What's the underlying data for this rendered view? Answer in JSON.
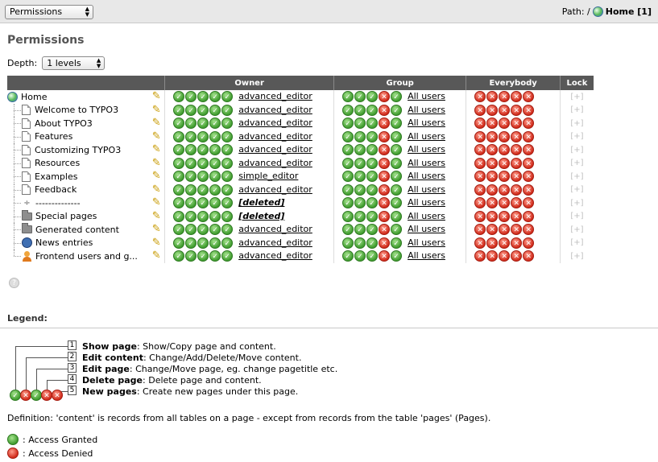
{
  "topbar": {
    "module_select": "Permissions",
    "path_label": "Path: /",
    "path_page": "Home [1]"
  },
  "page_title": "Permissions",
  "depth": {
    "label": "Depth:",
    "value": "1 levels"
  },
  "table": {
    "headers": {
      "owner": "Owner",
      "group": "Group",
      "everybody": "Everybody",
      "lock": "Lock"
    },
    "rows": [
      {
        "title": "Home",
        "icon": "globe-icon",
        "owner": [
          1,
          1,
          1,
          1,
          1
        ],
        "owner_name": "advanced_editor",
        "group": [
          1,
          1,
          1,
          0,
          1
        ],
        "group_name": "All users",
        "every": [
          0,
          0,
          0,
          0,
          0
        ],
        "lock": "[+]"
      },
      {
        "title": "Welcome to TYPO3",
        "icon": "page-icon",
        "owner": [
          1,
          1,
          1,
          1,
          1
        ],
        "owner_name": "advanced_editor",
        "group": [
          1,
          1,
          1,
          0,
          1
        ],
        "group_name": "All users",
        "every": [
          0,
          0,
          0,
          0,
          0
        ],
        "lock": "[+]"
      },
      {
        "title": "About TYPO3",
        "icon": "page-icon",
        "owner": [
          1,
          1,
          1,
          1,
          1
        ],
        "owner_name": "advanced_editor",
        "group": [
          1,
          1,
          1,
          0,
          1
        ],
        "group_name": "All users",
        "every": [
          0,
          0,
          0,
          0,
          0
        ],
        "lock": "[+]"
      },
      {
        "title": "Features",
        "icon": "page-icon",
        "owner": [
          1,
          1,
          1,
          1,
          1
        ],
        "owner_name": "advanced_editor",
        "group": [
          1,
          1,
          1,
          0,
          1
        ],
        "group_name": "All users",
        "every": [
          0,
          0,
          0,
          0,
          0
        ],
        "lock": "[+]"
      },
      {
        "title": "Customizing TYPO3",
        "icon": "page-icon",
        "owner": [
          1,
          1,
          1,
          1,
          1
        ],
        "owner_name": "advanced_editor",
        "group": [
          1,
          1,
          1,
          0,
          1
        ],
        "group_name": "All users",
        "every": [
          0,
          0,
          0,
          0,
          0
        ],
        "lock": "[+]"
      },
      {
        "title": "Resources",
        "icon": "page-icon",
        "owner": [
          1,
          1,
          1,
          1,
          1
        ],
        "owner_name": "advanced_editor",
        "group": [
          1,
          1,
          1,
          0,
          1
        ],
        "group_name": "All users",
        "every": [
          0,
          0,
          0,
          0,
          0
        ],
        "lock": "[+]"
      },
      {
        "title": "Examples",
        "icon": "page-icon",
        "owner": [
          1,
          1,
          1,
          1,
          1
        ],
        "owner_name": "simple_editor",
        "group": [
          1,
          1,
          1,
          0,
          1
        ],
        "group_name": "All users",
        "every": [
          0,
          0,
          0,
          0,
          0
        ],
        "lock": "[+]"
      },
      {
        "title": "Feedback",
        "icon": "page-icon",
        "owner": [
          1,
          1,
          1,
          1,
          1
        ],
        "owner_name": "advanced_editor",
        "group": [
          1,
          1,
          1,
          0,
          1
        ],
        "group_name": "All users",
        "every": [
          0,
          0,
          0,
          0,
          0
        ],
        "lock": "[+]"
      },
      {
        "title": "--------------",
        "icon": "spacer-icon",
        "owner": [
          1,
          1,
          1,
          1,
          1
        ],
        "owner_name": "[deleted]",
        "deleted": true,
        "group": [
          1,
          1,
          1,
          0,
          1
        ],
        "group_name": "All users",
        "every": [
          0,
          0,
          0,
          0,
          0
        ],
        "lock": "[+]"
      },
      {
        "title": "Special pages",
        "icon": "folder-icon",
        "owner": [
          1,
          1,
          1,
          1,
          1
        ],
        "owner_name": "[deleted]",
        "deleted": true,
        "group": [
          1,
          1,
          1,
          0,
          1
        ],
        "group_name": "All users",
        "every": [
          0,
          0,
          0,
          0,
          0
        ],
        "lock": "[+]"
      },
      {
        "title": "Generated content",
        "icon": "folder-icon",
        "owner": [
          1,
          1,
          1,
          1,
          1
        ],
        "owner_name": "advanced_editor",
        "group": [
          1,
          1,
          1,
          0,
          1
        ],
        "group_name": "All users",
        "every": [
          0,
          0,
          0,
          0,
          0
        ],
        "lock": "[+]"
      },
      {
        "title": "News entries",
        "icon": "news-icon",
        "owner": [
          1,
          1,
          1,
          1,
          1
        ],
        "owner_name": "advanced_editor",
        "group": [
          1,
          1,
          1,
          0,
          1
        ],
        "group_name": "All users",
        "every": [
          0,
          0,
          0,
          0,
          0
        ],
        "lock": "[+]"
      },
      {
        "title": "Frontend users and g...",
        "icon": "user-icon",
        "owner": [
          1,
          1,
          1,
          1,
          1
        ],
        "owner_name": "advanced_editor",
        "group": [
          1,
          1,
          1,
          0,
          1
        ],
        "group_name": "All users",
        "every": [
          0,
          0,
          0,
          0,
          0
        ],
        "lock": "[+]"
      }
    ]
  },
  "legend": {
    "title": "Legend:",
    "items": [
      {
        "num": "1",
        "bold": "Show page",
        "text": ": Show/Copy page and content."
      },
      {
        "num": "2",
        "bold": "Edit content",
        "text": ": Change/Add/Delete/Move content."
      },
      {
        "num": "3",
        "bold": "Edit page",
        "text": ": Change/Move page, eg. change pagetitle etc."
      },
      {
        "num": "4",
        "bold": "Delete page",
        "text": ": Delete page and content."
      },
      {
        "num": "5",
        "bold": "New pages",
        "text": ": Create new pages under this page."
      }
    ],
    "sample": [
      1,
      0,
      1,
      0,
      0
    ],
    "definition": "Definition: 'content' is records from all tables on a page - except from records from the table 'pages' (Pages).",
    "granted": ": Access Granted",
    "denied": ": Access Denied"
  },
  "colors": {
    "granted": "#3f9c2e",
    "denied": "#d12b1b",
    "header_bg": "#585858"
  }
}
